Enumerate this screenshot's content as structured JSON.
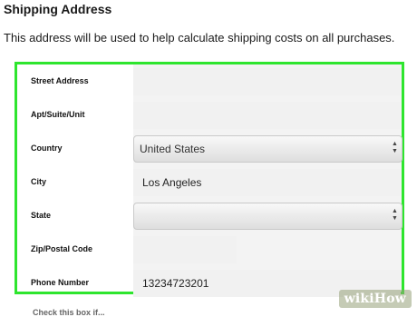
{
  "header": {
    "title": "Shipping Address",
    "description": "This address will be used to help calculate shipping costs on all purchases."
  },
  "form": {
    "street": {
      "label": "Street Address",
      "value": ""
    },
    "apt": {
      "label": "Apt/Suite/Unit",
      "value": ""
    },
    "country": {
      "label": "Country",
      "value": "United States"
    },
    "city": {
      "label": "City",
      "value": "Los Angeles"
    },
    "state": {
      "label": "State",
      "value": ""
    },
    "zip": {
      "label": "Zip/Postal Code",
      "value": ""
    },
    "phone": {
      "label": "Phone Number",
      "value": "13234723201"
    }
  },
  "below": {
    "partial_text": "Check this box if..."
  },
  "watermark": {
    "wiki": "wiki",
    "how": "How"
  },
  "colors": {
    "highlight_border": "#2ee52e",
    "field_background": "#f1f1f1"
  },
  "icons": {
    "select_arrows": "up-down-arrows-icon"
  }
}
